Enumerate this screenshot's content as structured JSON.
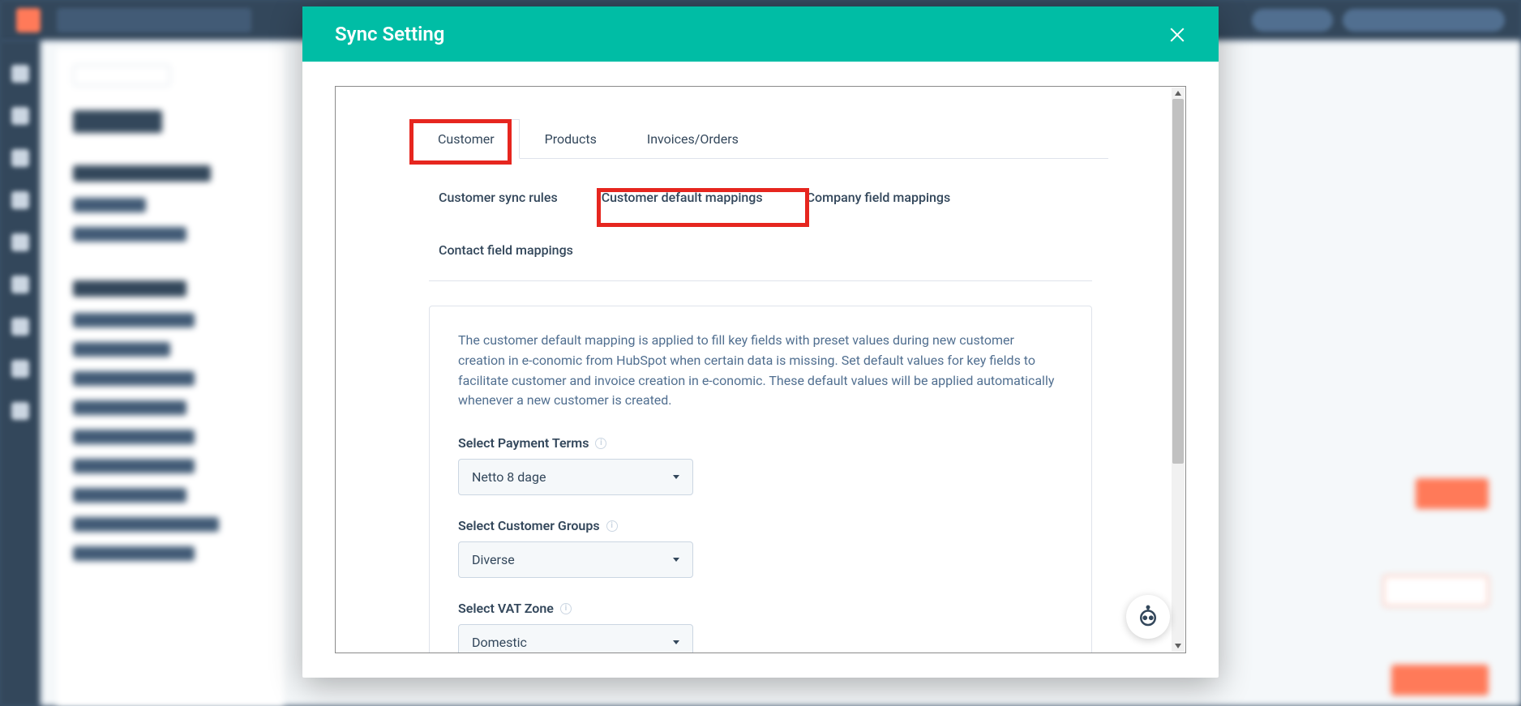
{
  "modal": {
    "title": "Sync Setting",
    "tabs": [
      {
        "id": "customer",
        "label": "Customer",
        "active": true
      },
      {
        "id": "products",
        "label": "Products",
        "active": false
      },
      {
        "id": "invoices",
        "label": "Invoices/Orders",
        "active": false
      }
    ],
    "subTabs": [
      {
        "id": "sync-rules",
        "label": "Customer sync rules"
      },
      {
        "id": "default-mappings",
        "label": "Customer default mappings"
      },
      {
        "id": "company-mappings",
        "label": "Company field mappings"
      },
      {
        "id": "contact-mappings",
        "label": "Contact field mappings"
      }
    ],
    "helperText": "The customer default mapping is applied to fill key fields with preset values during new customer creation in e-conomic from HubSpot when certain data is missing. Set default values for key fields to facilitate customer and invoice creation in e-conomic. These default values will be applied automatically whenever a new customer is created.",
    "fields": {
      "paymentTerms": {
        "label": "Select Payment Terms",
        "value": "Netto 8 dage"
      },
      "customerGroups": {
        "label": "Select Customer Groups",
        "value": "Diverse"
      },
      "vatZone": {
        "label": "Select VAT Zone",
        "value": "Domestic"
      }
    }
  }
}
